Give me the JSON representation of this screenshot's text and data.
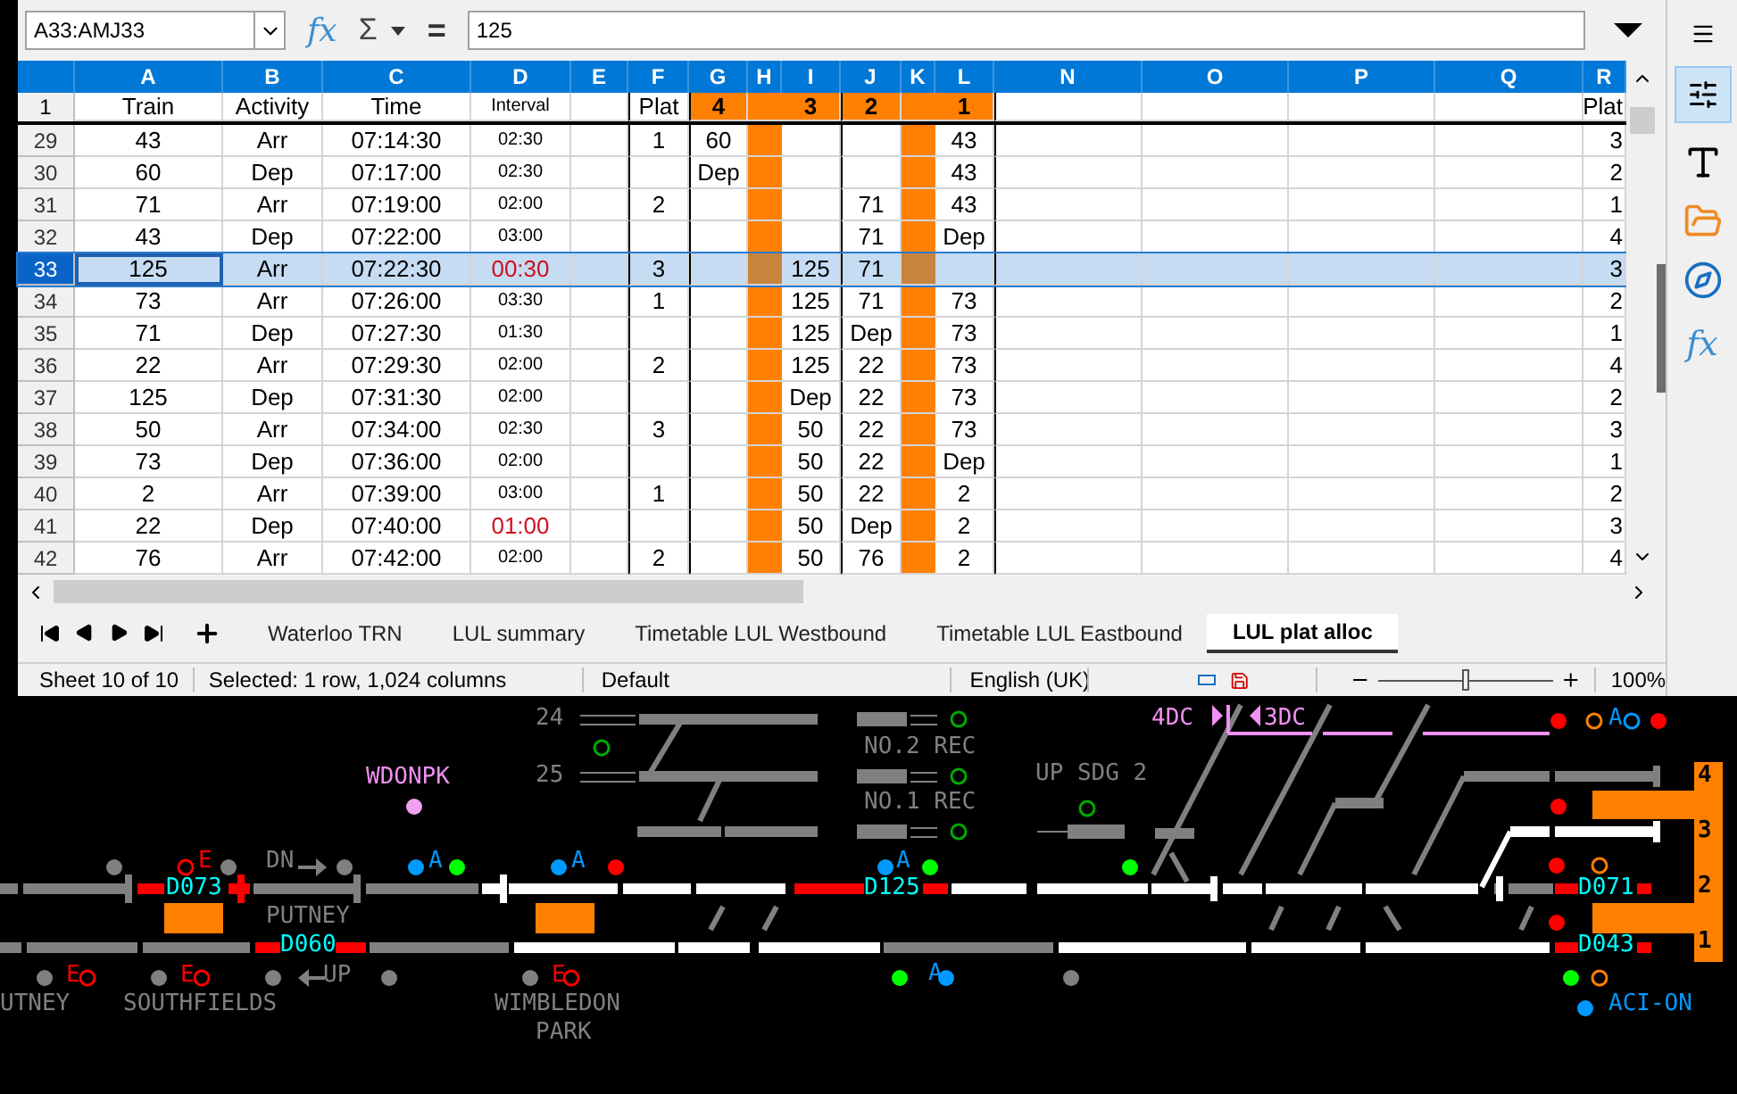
{
  "formula_bar": {
    "name_box": "A33:AMJ33",
    "function_symbol": "fx",
    "sum_symbol": "Σ",
    "equals_symbol": "=",
    "formula": "125"
  },
  "sidebar": {
    "function_symbol": "fx"
  },
  "columns": [
    "A",
    "B",
    "C",
    "D",
    "E",
    "F",
    "G",
    "H",
    "I",
    "J",
    "K",
    "L",
    "N",
    "O",
    "P",
    "Q",
    "R"
  ],
  "header_row": {
    "number": "1",
    "train": "Train",
    "activity": "Activity",
    "time": "Time",
    "interval": "Interval",
    "plat": "Plat",
    "p4": "4",
    "p3": "3",
    "p2": "2",
    "p1": "1",
    "col_r": "Plat"
  },
  "rows": [
    {
      "number": "29",
      "train": "43",
      "activity": "Arr",
      "time": "07:14:30",
      "interval": "02:30",
      "interval_alert": false,
      "plat": "1",
      "p4": "60",
      "p1": "43",
      "col_r": "3",
      "selected": false
    },
    {
      "number": "30",
      "train": "60",
      "activity": "Dep",
      "time": "07:17:00",
      "interval": "02:30",
      "interval_alert": false,
      "p4": "Dep",
      "p1": "43",
      "col_r": "2",
      "selected": false
    },
    {
      "number": "31",
      "train": "71",
      "activity": "Arr",
      "time": "07:19:00",
      "interval": "02:00",
      "interval_alert": false,
      "plat": "2",
      "p2": "71",
      "p1": "43",
      "col_r": "1",
      "selected": false
    },
    {
      "number": "32",
      "train": "43",
      "activity": "Dep",
      "time": "07:22:00",
      "interval": "03:00",
      "interval_alert": false,
      "p2": "71",
      "p1": "Dep",
      "col_r": "4",
      "selected": false
    },
    {
      "number": "33",
      "train": "125",
      "activity": "Arr",
      "time": "07:22:30",
      "interval": "00:30",
      "interval_alert": true,
      "plat": "3",
      "p3": "125",
      "p2": "71",
      "col_r": "3",
      "selected": true
    },
    {
      "number": "34",
      "train": "73",
      "activity": "Arr",
      "time": "07:26:00",
      "interval": "03:30",
      "interval_alert": false,
      "plat": "1",
      "p3": "125",
      "p2": "71",
      "p1": "73",
      "col_r": "2",
      "selected": false
    },
    {
      "number": "35",
      "train": "71",
      "activity": "Dep",
      "time": "07:27:30",
      "interval": "01:30",
      "interval_alert": false,
      "p3": "125",
      "p2": "Dep",
      "p1": "73",
      "col_r": "1",
      "selected": false
    },
    {
      "number": "36",
      "train": "22",
      "activity": "Arr",
      "time": "07:29:30",
      "interval": "02:00",
      "interval_alert": false,
      "plat": "2",
      "p3": "125",
      "p2": "22",
      "p1": "73",
      "col_r": "4",
      "selected": false
    },
    {
      "number": "37",
      "train": "125",
      "activity": "Dep",
      "time": "07:31:30",
      "interval": "02:00",
      "interval_alert": false,
      "p3": "Dep",
      "p2": "22",
      "p1": "73",
      "col_r": "2",
      "selected": false
    },
    {
      "number": "38",
      "train": "50",
      "activity": "Arr",
      "time": "07:34:00",
      "interval": "02:30",
      "interval_alert": false,
      "plat": "3",
      "p3": "50",
      "p2": "22",
      "p1": "73",
      "col_r": "3",
      "selected": false
    },
    {
      "number": "39",
      "train": "73",
      "activity": "Dep",
      "time": "07:36:00",
      "interval": "02:00",
      "interval_alert": false,
      "p3": "50",
      "p2": "22",
      "p1": "Dep",
      "col_r": "1",
      "selected": false
    },
    {
      "number": "40",
      "train": "2",
      "activity": "Arr",
      "time": "07:39:00",
      "interval": "03:00",
      "interval_alert": false,
      "plat": "1",
      "p3": "50",
      "p2": "22",
      "p1": "2",
      "col_r": "2",
      "selected": false
    },
    {
      "number": "41",
      "train": "22",
      "activity": "Dep",
      "time": "07:40:00",
      "interval": "01:00",
      "interval_alert": true,
      "p3": "50",
      "p2": "Dep",
      "p1": "2",
      "col_r": "3",
      "selected": false
    },
    {
      "number": "42",
      "train": "76",
      "activity": "Arr",
      "time": "07:42:00",
      "interval": "02:00",
      "interval_alert": false,
      "plat": "2",
      "p3": "50",
      "p2": "76",
      "p1": "2",
      "col_r": "4",
      "selected": false
    }
  ],
  "sheet_tabs": [
    {
      "label": "Waterloo TRN",
      "selected": false
    },
    {
      "label": "LUL summary",
      "selected": false
    },
    {
      "label": "Timetable LUL Westbound",
      "selected": false
    },
    {
      "label": "Timetable LUL Eastbound",
      "selected": false
    },
    {
      "label": "LUL plat alloc",
      "selected": true
    }
  ],
  "status_bar": {
    "sheet": "Sheet 10 of 10",
    "selection": "Selected: 1 row, 1,024 columns",
    "page_style": "Default",
    "language": "English (UK)",
    "zoom": {
      "level": 0.5
    },
    "zoom_percent": "100%"
  },
  "diagram": {
    "labels": [
      {
        "text": "24",
        "color": "#808080"
      },
      {
        "text": "25",
        "color": "#808080"
      },
      {
        "text": "NO.2 REC",
        "color": "#808080"
      },
      {
        "text": "NO.1 REC",
        "color": "#808080"
      },
      {
        "text": "UP SDG 2",
        "color": "#808080"
      },
      {
        "text": "4DC",
        "color": "#f090f0"
      },
      {
        "text": "3DC",
        "color": "#f090f0"
      },
      {
        "text": "WDONPK",
        "color": "#f090f0"
      },
      {
        "text": "E",
        "color": "#ff0000"
      },
      {
        "text": "DN",
        "color": "#808080"
      },
      {
        "text": "A",
        "color": "#0099ff"
      },
      {
        "text": "A",
        "color": "#0099ff"
      },
      {
        "text": "A",
        "color": "#0099ff"
      },
      {
        "text": "A",
        "color": "#0099ff"
      },
      {
        "text": "D073",
        "color": "#00ffff"
      },
      {
        "text": "D125",
        "color": "#00ffff"
      },
      {
        "text": "D071",
        "color": "#00ffff"
      },
      {
        "text": "PUTNEY",
        "color": "#808080"
      },
      {
        "text": "D060",
        "color": "#00ffff"
      },
      {
        "text": "D043",
        "color": "#00ffff"
      },
      {
        "text": "E",
        "color": "#ff0000"
      },
      {
        "text": "E",
        "color": "#ff0000"
      },
      {
        "text": "UP",
        "color": "#808080"
      },
      {
        "text": "E",
        "color": "#ff0000"
      },
      {
        "text": "A",
        "color": "#0099ff"
      },
      {
        "text": "UTNEY",
        "color": "#808080"
      },
      {
        "text": "SOUTHFIELDS",
        "color": "#808080"
      },
      {
        "text": "WIMBLEDON",
        "color": "#808080"
      },
      {
        "text": "PARK",
        "color": "#808080"
      },
      {
        "text": "ACI-ON",
        "color": "#0099ff"
      }
    ],
    "platforms": [
      "4",
      "3",
      "2",
      "1"
    ]
  }
}
